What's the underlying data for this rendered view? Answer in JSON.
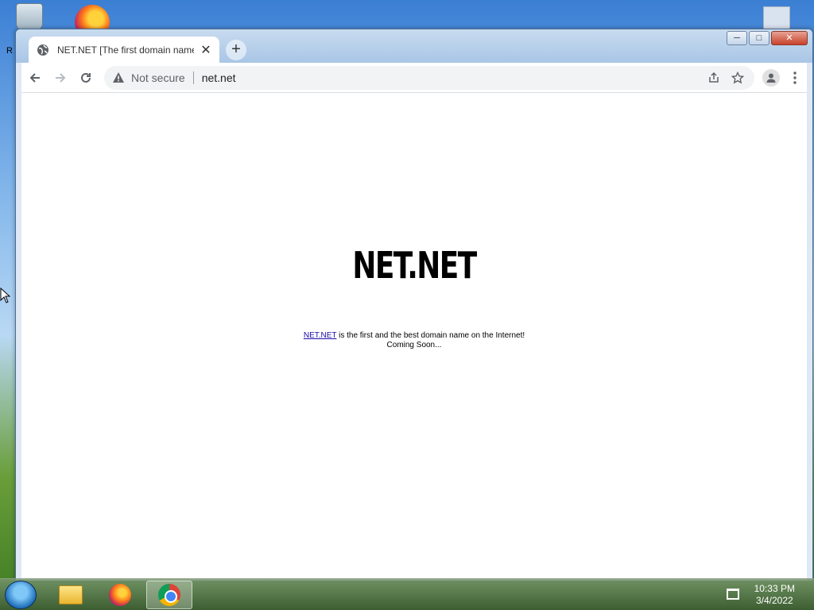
{
  "desktop": {
    "left_label": "R"
  },
  "browser": {
    "tab": {
      "title": "NET.NET [The first domain name",
      "close_glyph": "✕"
    },
    "new_tab_glyph": "+",
    "window_buttons": {
      "minimize": "─",
      "maximize": "□",
      "close": "✕"
    },
    "toolbar": {
      "security_label": "Not secure",
      "url": "net.net"
    }
  },
  "page": {
    "heading": "NET.NET",
    "link_text": "NET.NET",
    "line1_rest": " is the first and the best domain name on the Internet!",
    "line2": "Coming Soon..."
  },
  "taskbar": {
    "clock_time": "10:33 PM",
    "clock_date": "3/4/2022"
  }
}
